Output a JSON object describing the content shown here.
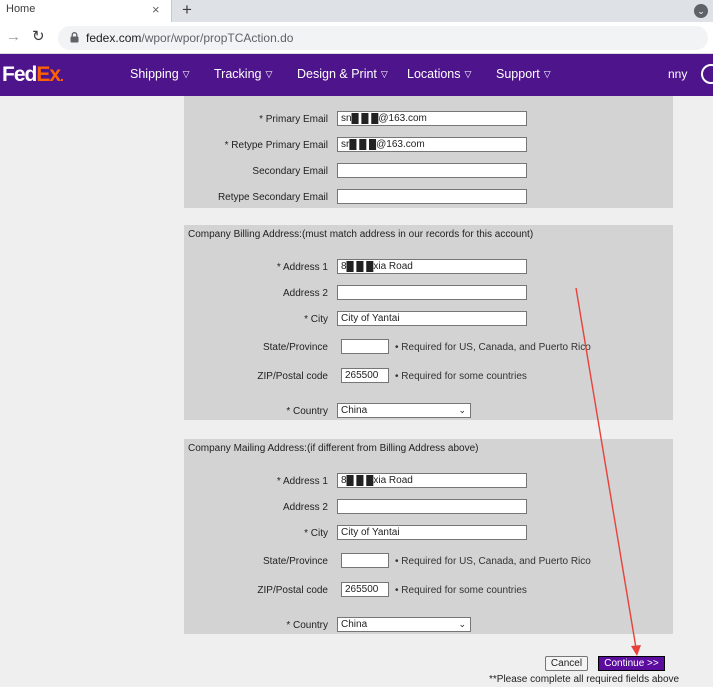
{
  "browser": {
    "tab_title": "Home",
    "tab_close": "×",
    "new_tab": "+",
    "url_host": "fedex.com",
    "url_path": "/wpor/wpor/propTCAction.do"
  },
  "header": {
    "logo_fed": "Fed",
    "logo_ex": "Ex",
    "logo_dot": ".",
    "menu": [
      "Shipping",
      "Tracking",
      "Design & Print",
      "Locations",
      "Support"
    ],
    "user_name": "nny",
    "brand_color": "#4d148c"
  },
  "email": {
    "primary_label": "* Primary Email",
    "primary_value": "sn█ █ █@163.com",
    "retype_primary_label": "* Retype Primary Email",
    "retype_primary_value": "sr█ █ █@163.com",
    "secondary_label": "Secondary Email",
    "secondary_value": "",
    "retype_secondary_label": "Retype Secondary Email",
    "retype_secondary_value": ""
  },
  "billing": {
    "title": "Company Billing Address:(must match address in our records for this account)",
    "address1_label": "* Address 1",
    "address1_value": "8█ █ █xia Road",
    "address2_label": "Address 2",
    "address2_value": "",
    "city_label": "* City",
    "city_value": "City of Yantai",
    "state_label": "State/Province",
    "state_value": "",
    "state_note": "• Required for US, Canada, and Puerto Rico",
    "zip_label": "ZIP/Postal code",
    "zip_value": "265500",
    "zip_note": "• Required for some countries",
    "country_label": "* Country",
    "country_value": "China"
  },
  "mailing": {
    "title": "Company Mailing Address:(if different from Billing Address above)",
    "address1_label": "* Address 1",
    "address1_value": "8█ █ █xia Road",
    "address2_label": "Address 2",
    "address2_value": "",
    "city_label": "* City",
    "city_value": "City of Yantai",
    "state_label": "State/Province",
    "state_value": "",
    "state_note": "• Required for US, Canada, and Puerto Rico",
    "zip_label": "ZIP/Postal code",
    "zip_value": "265500",
    "zip_note": "• Required for some countries",
    "country_label": "* Country",
    "country_value": "China"
  },
  "actions": {
    "cancel_label": "Cancel",
    "continue_label": "Continue >>",
    "footnote": "**Please complete all required fields above",
    "annotation_arrow_color": "#e8413a"
  }
}
